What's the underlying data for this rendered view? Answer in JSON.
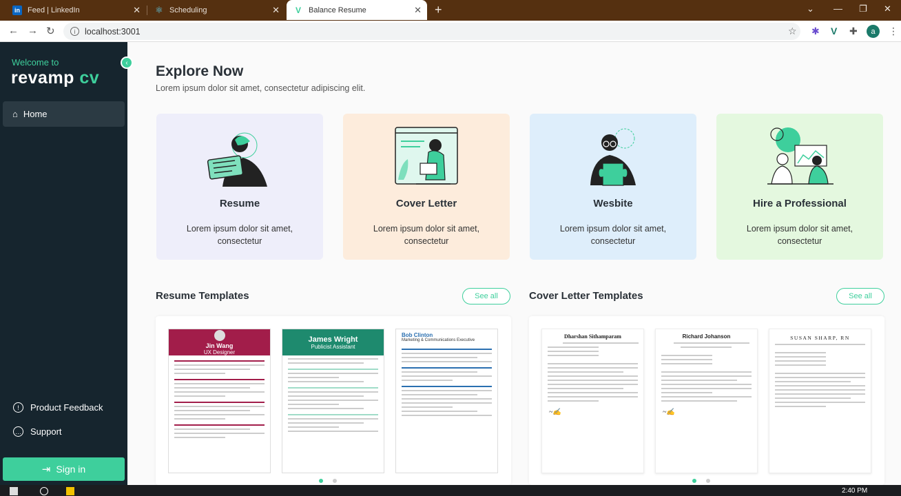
{
  "browser": {
    "tabs": [
      {
        "label": "Feed | LinkedIn",
        "icon": "linkedin-icon"
      },
      {
        "label": "Scheduling",
        "icon": "react-icon"
      },
      {
        "label": "Balance Resume",
        "icon": "revamp-v-icon",
        "active": true
      }
    ],
    "url": "localhost:3001",
    "profile_initial": "a"
  },
  "sidebar": {
    "welcome": "Welcome to",
    "logo_main": "revamp",
    "logo_accent": "cv",
    "home_label": "Home",
    "feedback_label": "Product Feedback",
    "support_label": "Support",
    "signin_label": "Sign in"
  },
  "main": {
    "title": "Explore Now",
    "subtitle": "Lorem ipsum dolor sit amet, consectetur adipiscing elit.",
    "cards": [
      {
        "title": "Resume",
        "desc": "Lorem ipsum dolor sit amet, consectetur",
        "bg": "#eeeefa"
      },
      {
        "title": "Cover Letter",
        "desc": "Lorem ipsum dolor sit amet, consectetur",
        "bg": "#fdecdc"
      },
      {
        "title": "Wesbite",
        "desc": "Lorem ipsum dolor sit amet, consectetur",
        "bg": "#deeefb"
      },
      {
        "title": "Hire a Professional",
        "desc": "Lorem ipsum dolor sit amet, consectetur",
        "bg": "#e4f8df"
      }
    ],
    "resume_templates": {
      "title": "Resume Templates",
      "see_all": "See all",
      "docs": [
        {
          "name": "Jin Wang",
          "role": "UX Designer",
          "color": "#a21d4a"
        },
        {
          "name": "James Wright",
          "role": "Publicist Assistant",
          "color": "#1e8a6e"
        },
        {
          "name": "Bob Clinton",
          "role": "Marketing & Communications Executive",
          "color": "#2a6fb0"
        }
      ]
    },
    "cover_templates": {
      "title": "Cover Letter Templates",
      "see_all": "See all",
      "docs": [
        {
          "name": "Dharshan Sithamparam"
        },
        {
          "name": "Richard Johanson"
        },
        {
          "name": "SUSAN SHARP, RN"
        }
      ]
    }
  },
  "taskbar": {
    "time": "2:40 PM"
  },
  "colors": {
    "accent": "#3ecf9c",
    "sidebar_bg": "#16252e",
    "tabstrip_bg": "#553010"
  }
}
